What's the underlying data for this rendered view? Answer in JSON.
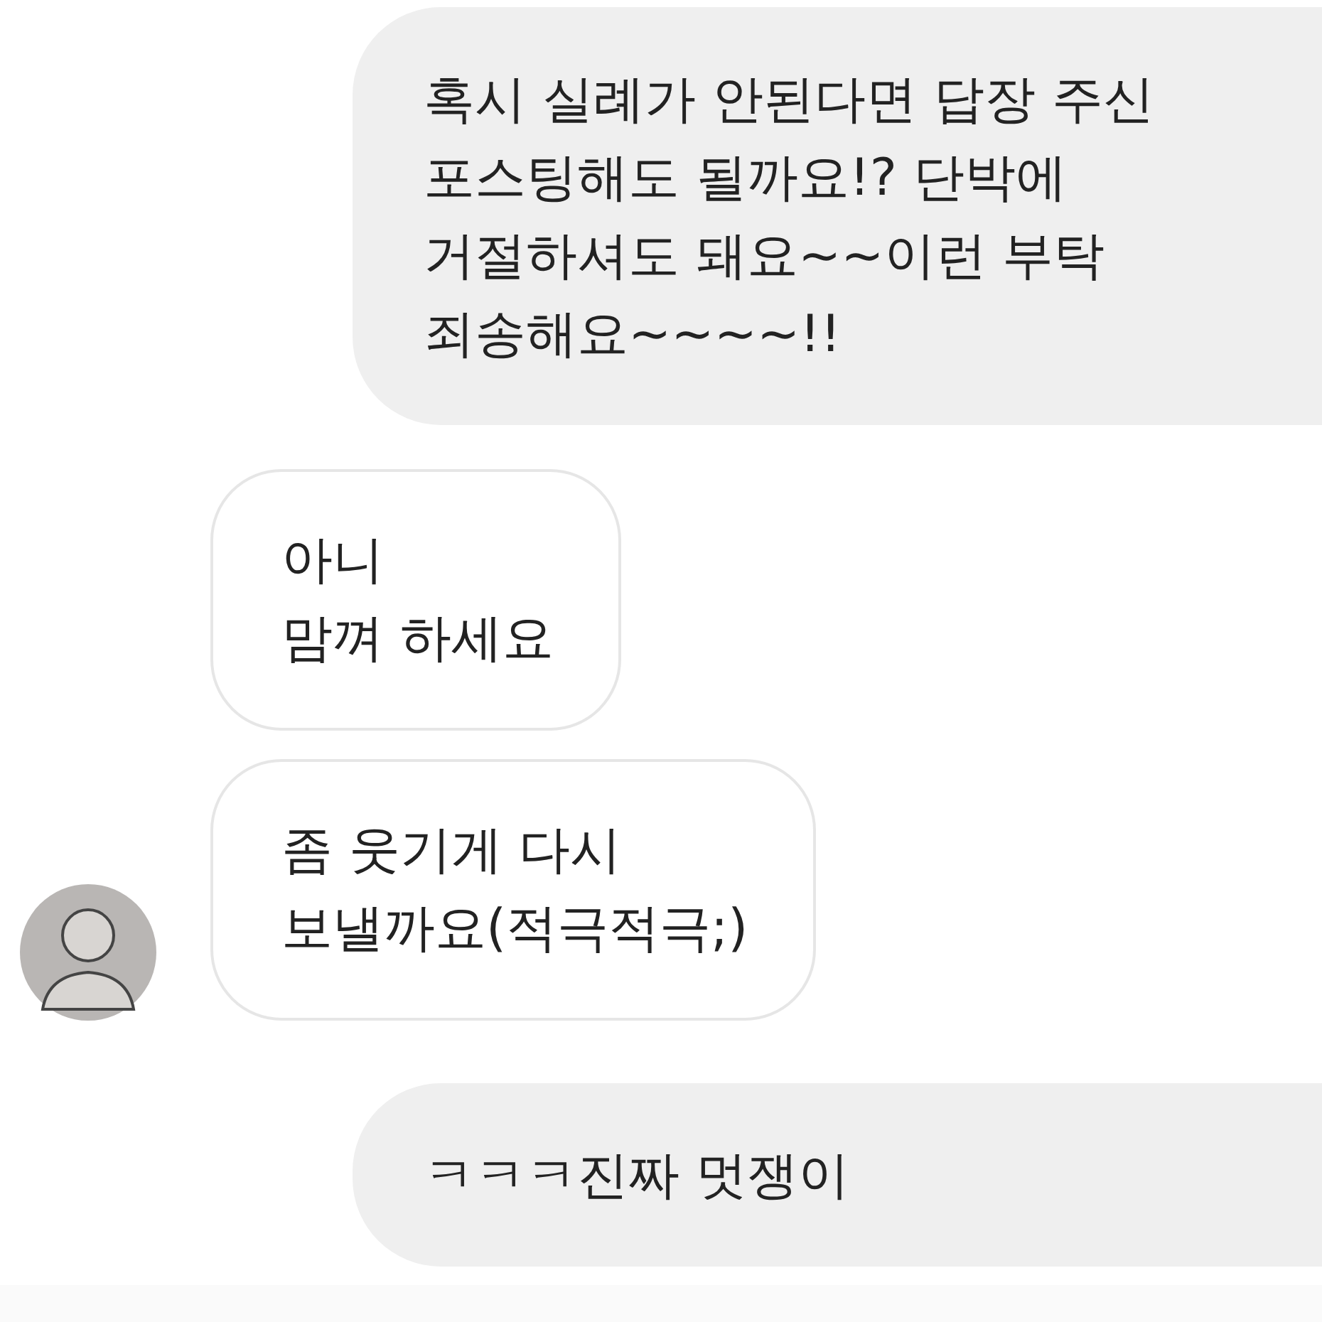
{
  "messages": [
    {
      "kind": "outgoing",
      "lines": [
        "혹시 실례가 안된다면 답장 주신",
        "포스팅해도 될까요!? 단박에",
        "거절하셔도 돼요~~이런 부탁",
        "죄송해요~~~~!!"
      ]
    },
    {
      "kind": "incoming",
      "lines": [
        "아니",
        "맘껴 하세요"
      ],
      "avatar": false
    },
    {
      "kind": "incoming",
      "lines": [
        "좀 웃기게 다시",
        "보낼까요(적극적극;)"
      ],
      "avatar": true
    },
    {
      "kind": "outgoing",
      "lines": [
        "ㅋㅋㅋ진짜 멋쟁이"
      ]
    }
  ]
}
